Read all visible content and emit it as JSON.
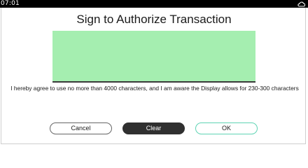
{
  "status_bar": {
    "time": "07:01",
    "icon": "cloud-icon"
  },
  "dialog": {
    "title": "Sign to Authorize Transaction",
    "agreement_text": "I hereby agree to use no more than 4000 characters, and I am aware the Display allows for 230-300 characters"
  },
  "signature_pad": {
    "fill_color": "#a5eeb0"
  },
  "buttons": {
    "cancel_label": "Cancel",
    "clear_label": "Clear",
    "ok_label": "OK"
  },
  "colors": {
    "status_bar_bg": "#000000",
    "clear_button_bg": "#303030",
    "ok_button_border": "#5fd4b4"
  }
}
